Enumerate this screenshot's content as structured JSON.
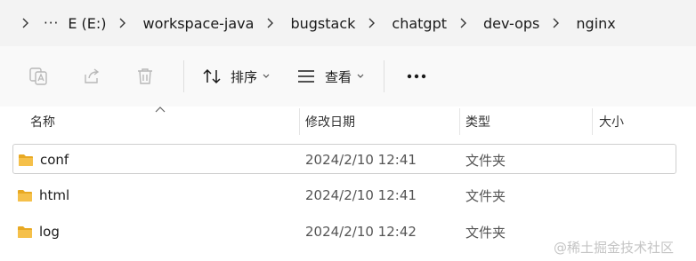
{
  "breadcrumb": {
    "overflow": "···",
    "items": [
      "E (E:)",
      "workspace-java",
      "bugstack",
      "chatgpt",
      "dev-ops",
      "nginx"
    ]
  },
  "toolbar": {
    "icons": [
      "translate-icon",
      "share-icon",
      "delete-icon"
    ],
    "sort_label": "排序",
    "view_label": "查看"
  },
  "columns": {
    "name": "名称",
    "modified": "修改日期",
    "type": "类型",
    "size": "大小"
  },
  "rows": [
    {
      "name": "conf",
      "modified": "2024/2/10 12:41",
      "type": "文件夹",
      "size": "",
      "selected": true
    },
    {
      "name": "html",
      "modified": "2024/2/10 12:41",
      "type": "文件夹",
      "size": "",
      "selected": false
    },
    {
      "name": "log",
      "modified": "2024/2/10 12:42",
      "type": "文件夹",
      "size": "",
      "selected": false
    }
  ],
  "watermark": "@稀土掘金技术社区",
  "colors": {
    "folder": "#f5c04a",
    "folder_dark": "#e8a923",
    "icon_disabled": "#b8b8b8",
    "icon_active": "#1a1a1a"
  }
}
